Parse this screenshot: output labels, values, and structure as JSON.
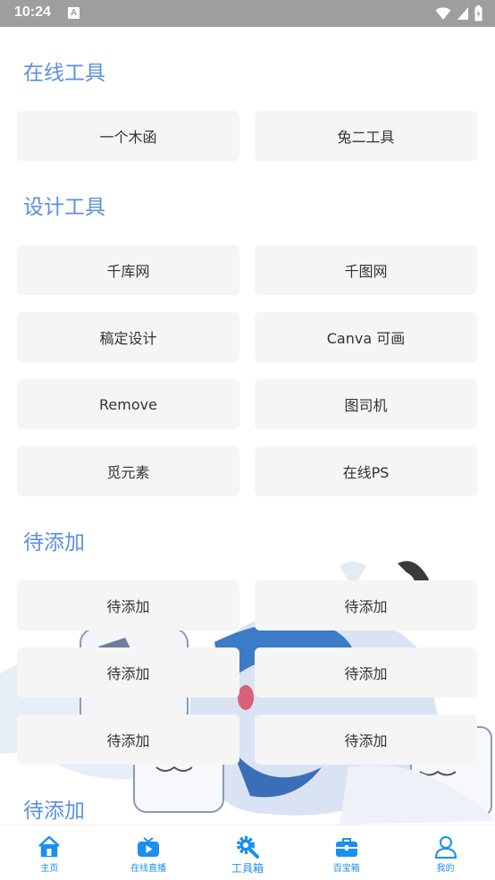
{
  "status_bar": {
    "time": "10:24",
    "notif": "A"
  },
  "sections": [
    {
      "title": "在线工具",
      "items": [
        "一个木函",
        "兔二工具"
      ]
    },
    {
      "title": "设计工具",
      "items": [
        "千库网",
        "千图网",
        "稿定设计",
        "Canva 可画",
        "Remove",
        "图司机",
        "觅元素",
        "在线PS"
      ]
    },
    {
      "title": "待添加",
      "items": [
        "待添加",
        "待添加",
        "待添加",
        "待添加",
        "待添加",
        "待添加"
      ]
    },
    {
      "title": "待添加"
    }
  ],
  "nav": [
    {
      "label": "主页",
      "icon": "home-icon"
    },
    {
      "label": "在线直播",
      "icon": "tv-icon"
    },
    {
      "label": "工具箱",
      "icon": "gear-wrench-icon",
      "active": true
    },
    {
      "label": "百宝箱",
      "icon": "briefcase-icon"
    },
    {
      "label": "我的",
      "icon": "user-icon"
    }
  ],
  "colors": {
    "accent": "#1a8ff0",
    "section_title": "#5b8fe0",
    "button_bg": "#f5f5f5",
    "status_bar": "#9e9e9e"
  }
}
